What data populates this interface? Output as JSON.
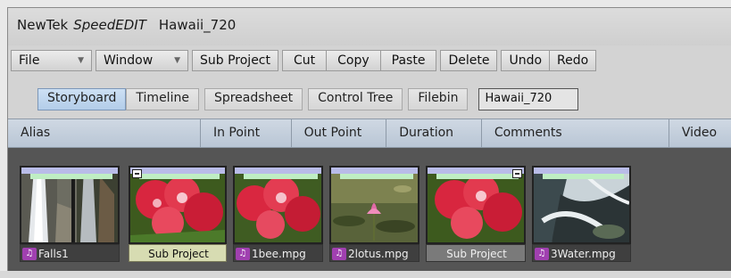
{
  "title": {
    "brand": "NewTek",
    "product": "SpeedEDIT",
    "project": "Hawaii_720"
  },
  "menubar": {
    "file": "File",
    "window": "Window",
    "sub_project": "Sub Project",
    "cut": "Cut",
    "copy": "Copy",
    "paste": "Paste",
    "delete": "Delete",
    "undo": "Undo",
    "redo": "Redo"
  },
  "tabs": [
    "Storyboard",
    "Timeline",
    "Spreadsheet",
    "Control Tree",
    "Filebin"
  ],
  "active_tab": "Storyboard",
  "project_field": "Hawaii_720",
  "columns": [
    "Alias",
    "In Point",
    "Out Point",
    "Duration",
    "Comments",
    "Video"
  ],
  "clips": [
    {
      "label": "Falls1",
      "audio": true,
      "type": "clip"
    },
    {
      "label": "Sub Project",
      "audio": false,
      "type": "subproject-selected"
    },
    {
      "label": "1bee.mpg",
      "audio": true,
      "type": "clip"
    },
    {
      "label": "2lotus.mpg",
      "audio": true,
      "type": "clip"
    },
    {
      "label": "Sub Project",
      "audio": false,
      "type": "subproject"
    },
    {
      "label": "3Water.mpg",
      "audio": true,
      "type": "clip"
    }
  ],
  "colors": {
    "storyboard_bg": "#555555",
    "active_tab": "#b3cde9",
    "audio_icon": "#a040b0"
  }
}
